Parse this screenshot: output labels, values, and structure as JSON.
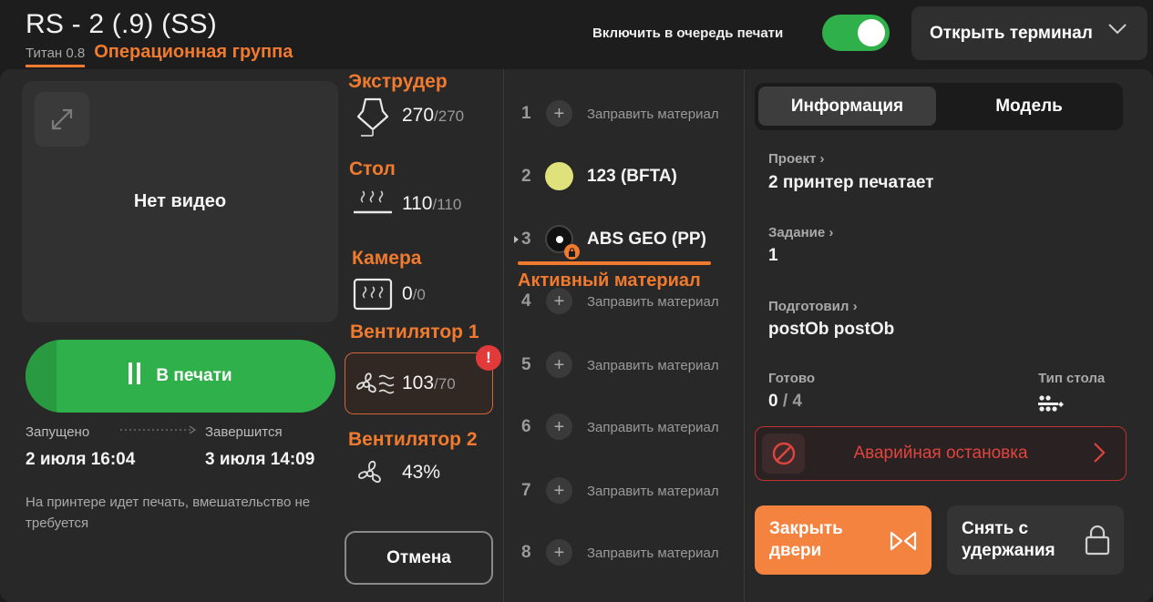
{
  "header": {
    "title": "RS - 2 (.9) (SS)",
    "printer_model": "Титан 0.8",
    "group_label": "Операционная группа",
    "queue_label": "Включить в очередь печати",
    "queue_enabled": true,
    "terminal_button": "Открыть терминал"
  },
  "video": {
    "no_video": "Нет видео"
  },
  "print": {
    "status_button": "В печати",
    "started_label": "Запущено",
    "started_value": "2 июля 16:04",
    "ends_label": "Завершится",
    "ends_value": "3 июля 14:09",
    "note": "На принтере идет печать, вмешательство не требуется",
    "progress": 0.1
  },
  "sensors": {
    "extruder": {
      "title": "Экструдер",
      "current": "270",
      "target": "/270"
    },
    "bed": {
      "title": "Стол",
      "current": "110",
      "target": "/110"
    },
    "chamber": {
      "title": "Камера",
      "current": "0",
      "target": "/0"
    },
    "fan1": {
      "title": "Вентилятор 1",
      "current": "103",
      "target": "/70",
      "warning": "!"
    },
    "fan2": {
      "title": "Вентилятор 2",
      "value": "43%"
    },
    "cancel_button": "Отмена"
  },
  "materials": {
    "active_label": "Активный материал",
    "fill_label": "Заправить материал",
    "slots": [
      {
        "num": "1",
        "name": ""
      },
      {
        "num": "2",
        "name": "123 (BFTA)",
        "color": "#dfe27a"
      },
      {
        "num": "3",
        "name": "ABS GEO (PP)",
        "color": "#111111",
        "locked": true,
        "active": true
      },
      {
        "num": "4",
        "name": ""
      },
      {
        "num": "5",
        "name": ""
      },
      {
        "num": "6",
        "name": ""
      },
      {
        "num": "7",
        "name": ""
      },
      {
        "num": "8",
        "name": ""
      }
    ]
  },
  "info": {
    "tab_info": "Информация",
    "tab_model": "Модель",
    "project_label": "Проект",
    "project_value": "2 принтер печатает",
    "task_label": "Задание",
    "task_value": "1",
    "prepared_label": "Подготовил",
    "prepared_value": "postOb postOb",
    "ready_label": "Готово",
    "ready_value": "0",
    "ready_total": "/ 4",
    "bed_type_label": "Тип стола",
    "estop_label": "Аварийная остановка",
    "close_doors_button": "Закрыть двери",
    "unhold_button": "Снять с удержания"
  },
  "colors": {
    "accent": "#f07a2e",
    "success": "#2fb04a",
    "danger": "#e0443f"
  }
}
